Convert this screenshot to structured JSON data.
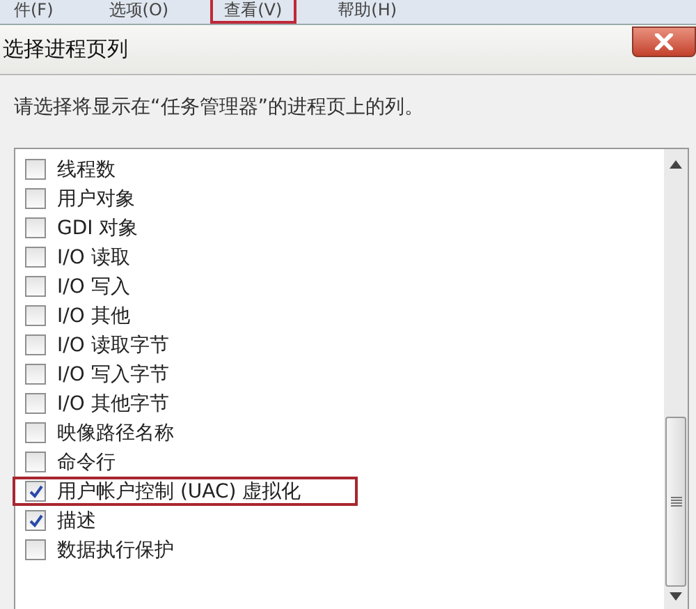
{
  "menu": [
    {
      "label": "件(F)",
      "highlighted": false
    },
    {
      "label": "选项(O)",
      "highlighted": false
    },
    {
      "label": "查看(V)",
      "highlighted": true
    },
    {
      "label": "帮助(H)",
      "highlighted": false
    }
  ],
  "dialog": {
    "title": "选择进程页列",
    "instruction": "请选择将显示在“任务管理器”的进程页上的列。"
  },
  "columns": [
    {
      "label": "线程数",
      "checked": false,
      "highlighted": false
    },
    {
      "label": "用户对象",
      "checked": false,
      "highlighted": false
    },
    {
      "label": "GDI 对象",
      "checked": false,
      "highlighted": false
    },
    {
      "label": "I/O 读取",
      "checked": false,
      "highlighted": false
    },
    {
      "label": "I/O 写入",
      "checked": false,
      "highlighted": false
    },
    {
      "label": "I/O 其他",
      "checked": false,
      "highlighted": false
    },
    {
      "label": "I/O 读取字节",
      "checked": false,
      "highlighted": false
    },
    {
      "label": "I/O 写入字节",
      "checked": false,
      "highlighted": false
    },
    {
      "label": "I/O 其他字节",
      "checked": false,
      "highlighted": false
    },
    {
      "label": "映像路径名称",
      "checked": false,
      "highlighted": false
    },
    {
      "label": "命令行",
      "checked": false,
      "highlighted": false
    },
    {
      "label": "用户帐户控制 (UAC) 虚拟化",
      "checked": true,
      "highlighted": true
    },
    {
      "label": "描述",
      "checked": true,
      "highlighted": false
    },
    {
      "label": "数据执行保护",
      "checked": false,
      "highlighted": false
    }
  ]
}
